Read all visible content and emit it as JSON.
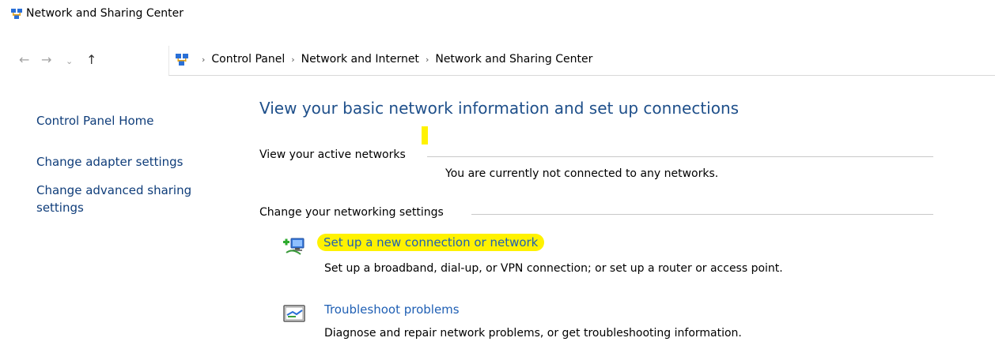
{
  "window": {
    "title": "Network and Sharing Center"
  },
  "nav": {
    "back": "←",
    "forward": "→",
    "dropdown": "⌄",
    "up": "↑"
  },
  "breadcrumbs": [
    {
      "label": "Control Panel"
    },
    {
      "label": "Network and Internet"
    },
    {
      "label": "Network and Sharing Center"
    }
  ],
  "breadcrumb_separator": "›",
  "sidebar": {
    "items": [
      {
        "label": "Control Panel Home"
      },
      {
        "label": "Change adapter settings"
      },
      {
        "label": "Change advanced sharing settings"
      }
    ]
  },
  "main": {
    "title": "View your basic network information and set up connections",
    "active_networks": {
      "label": "View your active networks",
      "status": "You are currently not connected to any networks."
    },
    "settings": {
      "label": "Change your networking settings",
      "tasks": [
        {
          "title": "Set up a new connection or network",
          "description": "Set up a broadband, dial-up, or VPN connection; or set up a router or access point.",
          "icon": "new-connection-icon",
          "highlighted": true
        },
        {
          "title": "Troubleshoot problems",
          "description": "Diagnose and repair network problems, or get troubleshooting information.",
          "icon": "troubleshoot-icon",
          "highlighted": false
        }
      ]
    }
  },
  "colors": {
    "accent_link": "#1f5fb4",
    "sidebar_link": "#0f3d7a",
    "title": "#1e4f8a",
    "highlight": "#fff200"
  }
}
